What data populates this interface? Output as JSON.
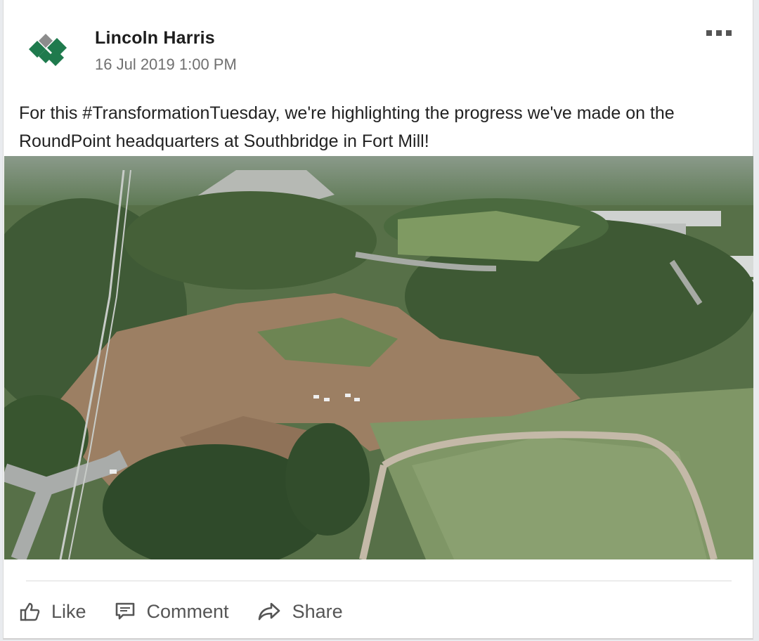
{
  "post": {
    "author": "Lincoln Harris",
    "timestamp": "16 Jul 2019 1:00 PM",
    "text": "For this #TransformationTuesday, we're highlighting the progress we've made on the RoundPoint headquarters at Southbridge in Fort Mill!",
    "avatar_icon": "green-diamond-logo-icon",
    "menu_icon": "more-options-icon"
  },
  "actions": {
    "like_label": "Like",
    "comment_label": "Comment",
    "share_label": "Share",
    "like_icon": "thumbs-up-icon",
    "comment_icon": "comment-bubble-icon",
    "share_icon": "share-arrow-icon"
  },
  "colors": {
    "logo_green": "#1f7a4d",
    "logo_gray": "#8c8c8c",
    "action_gray": "#555555",
    "timestamp_gray": "#707070"
  }
}
